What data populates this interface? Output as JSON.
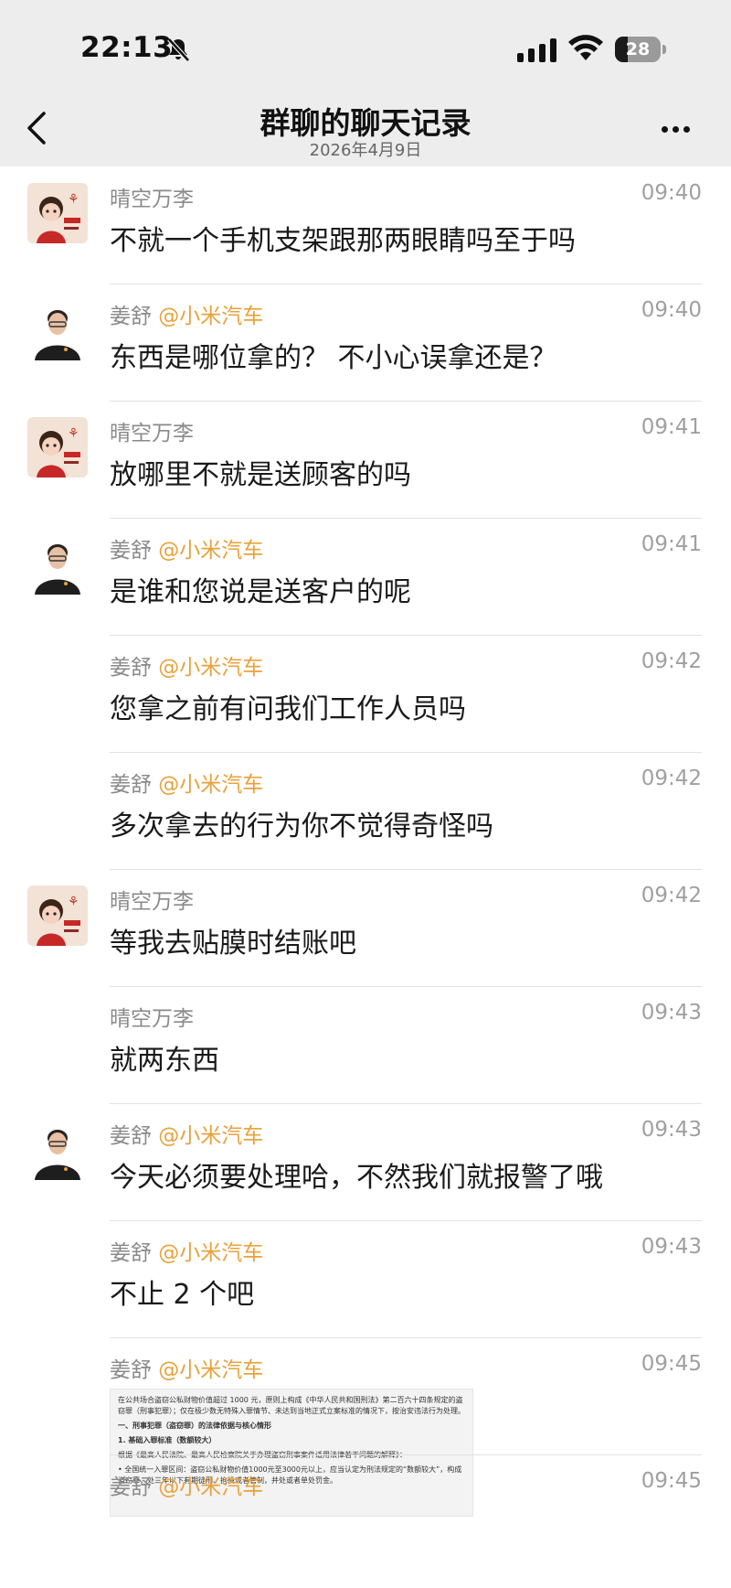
{
  "status_bar": {
    "time": "22:13",
    "battery": "28",
    "battery_level": 0.28
  },
  "header": {
    "title": "群聊的聊天记录",
    "date": "2026年4月9日"
  },
  "colors": {
    "accent_tag": "#e8a23c",
    "header_bg": "#ededed"
  },
  "messages": [
    {
      "name": "晴空万李",
      "tag": "",
      "time": "09:40",
      "text": "不就一个手机支架跟那两眼睛吗至于吗",
      "avatar": "girl-avatar"
    },
    {
      "name": "姜舒",
      "tag": "@小米汽车",
      "time": "09:40",
      "text": "东西是哪位拿的？ 不小心误拿还是？",
      "avatar": "man-avatar"
    },
    {
      "name": "晴空万李",
      "tag": "",
      "time": "09:41",
      "text": "放哪里不就是送顾客的吗",
      "avatar": "girl-avatar"
    },
    {
      "name": "姜舒",
      "tag": "@小米汽车",
      "time": "09:41",
      "text": "是谁和您说是送客户的呢",
      "avatar": "man-avatar"
    },
    {
      "name": "姜舒",
      "tag": "@小米汽车",
      "time": "09:42",
      "text": "您拿之前有问我们工作人员吗",
      "avatar": ""
    },
    {
      "name": "姜舒",
      "tag": "@小米汽车",
      "time": "09:42",
      "text": "多次拿去的行为你不觉得奇怪吗",
      "avatar": ""
    },
    {
      "name": "晴空万李",
      "tag": "",
      "time": "09:42",
      "text": "等我去贴膜时结账吧",
      "avatar": "girl-avatar"
    },
    {
      "name": "晴空万李",
      "tag": "",
      "time": "09:43",
      "text": "就两东西",
      "avatar": ""
    },
    {
      "name": "姜舒",
      "tag": "@小米汽车",
      "time": "09:43",
      "text": "今天必须要处理哈，不然我们就报警了哦",
      "avatar": "man-avatar"
    },
    {
      "name": "姜舒",
      "tag": "@小米汽车",
      "time": "09:43",
      "text": "不止 2 个吧",
      "avatar": ""
    },
    {
      "name": "姜舒",
      "tag": "@小米汽车",
      "time": "09:45",
      "text": "",
      "avatar": ""
    },
    {
      "name": "姜舒",
      "tag": "@小米汽车",
      "time": "09:45",
      "text": "",
      "avatar": ""
    }
  ],
  "document": {
    "p1": "在公共场合盗窃公私财物价值超过 1000 元，原则上构成《中华人民共和国刑法》第二百六十四条规定的盗窃罪（刑事犯罪）；仅在极少数无特殊入罪情节、未达到当地正式立案标准的情况下，按治安违法行为处理。",
    "h1": "一、刑事犯罪（盗窃罪）的法律依据与核心情形",
    "h2": "1. 基础入罪标准（数额较大）",
    "p2": "根据《最高人民法院、最高人民检察院关于办理盗窃刑事案件适用法律若干问题的解释》：",
    "p3": "• 全国统一入罪区间：盗窃公私财物价值1000元至3000元以上，应当认定为刑法规定的“数额较大”，构成盗窃罪，处三年以下有期徒刑、拘役或者管制，并处或者单处罚金。"
  }
}
